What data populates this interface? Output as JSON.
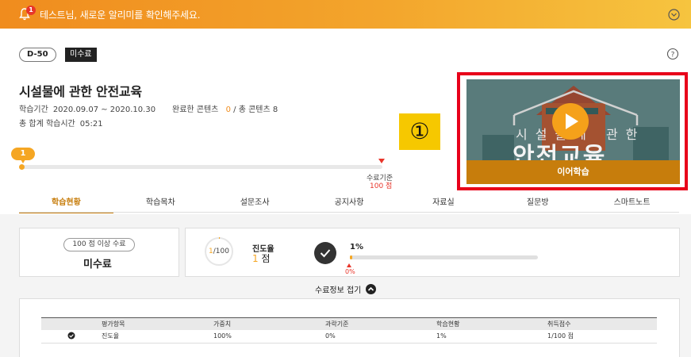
{
  "notice": {
    "badge_count": "1",
    "text": "테스트님, 새로운 알리미를 확인해주세요.",
    "bell_icon": "bell-icon",
    "toggle_icon": "chevron-down-circle-icon"
  },
  "course": {
    "dday": "D-50",
    "status_tag": "미수료",
    "title": "시설물에 관한 안전교육",
    "period_label": "학습기간",
    "period_value": "2020.09.07 ~ 2020.10.30",
    "completed_label": "완료한 콘텐츠",
    "completed_value": "0",
    "total_label": "/ 총 콘텐츠 8",
    "study_time_label": "총 합계 학습시간",
    "study_time_value": "05:21"
  },
  "progress": {
    "bubble": "1",
    "target_label": "수료기준",
    "target_value": "100 점",
    "current_fraction": 0.01
  },
  "callout": "①",
  "video": {
    "thumb_small_text": "시설물에 관한",
    "thumb_big_text": "안전교육",
    "resume_label": "이어학습",
    "play_icon": "play-icon"
  },
  "tabs": [
    "학습현황",
    "학습목차",
    "설문조사",
    "공지사항",
    "자료실",
    "질문방",
    "스마트노트"
  ],
  "summary": {
    "requirement_pill": "100 점 이상 수료",
    "status": "미수료",
    "ring_current": "1",
    "ring_total": "/100",
    "rate_label": "진도율",
    "rate_value": "1",
    "rate_unit": "점",
    "percent_label": "1%",
    "percent_fraction": 0.01,
    "zero_label": "0%"
  },
  "fold_toggle": "수료정보 접기",
  "grades_table": {
    "headers": [
      "평가항목",
      "가중치",
      "과락기준",
      "학습현황",
      "취득점수"
    ],
    "rows": [
      {
        "item": "진도율",
        "weight": "100%",
        "cutoff": "0%",
        "status": "1%",
        "score": "1/100 점"
      }
    ]
  },
  "colors": {
    "accent": "#f5a623",
    "brand": "#c77d0c",
    "highlight": "#e8001a"
  }
}
